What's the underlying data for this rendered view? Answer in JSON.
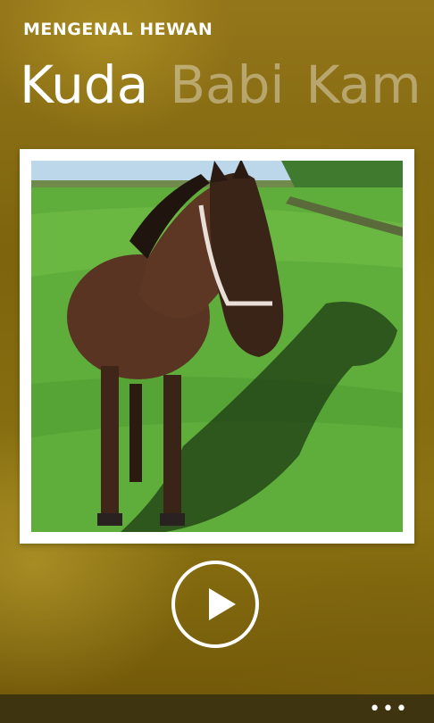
{
  "app": {
    "title": "MENGENAL HEWAN"
  },
  "pivot": {
    "items": [
      {
        "label": "Kuda",
        "active": true
      },
      {
        "label": "Babi",
        "active": false
      },
      {
        "label": "Kam",
        "active": false
      }
    ]
  },
  "photo": {
    "subject": "horse-photo"
  },
  "player": {
    "icon": "play-icon"
  },
  "appbar": {
    "more_label": "•••"
  },
  "colors": {
    "background": "#8a6f10",
    "frame": "#ffffff",
    "text": "#ffffff"
  }
}
